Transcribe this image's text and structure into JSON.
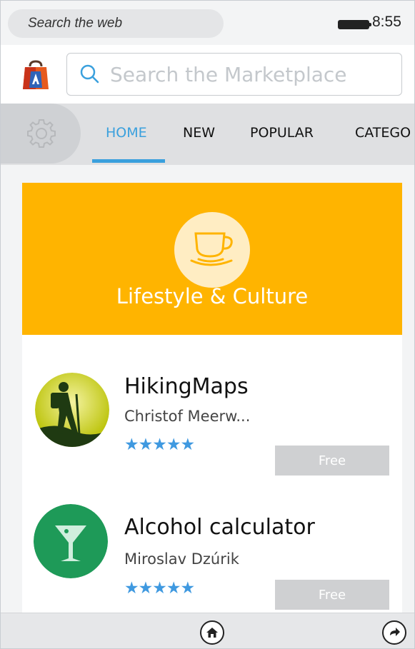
{
  "status_bar": {
    "search_text": "Search the web",
    "time": "8:55"
  },
  "marketplace_search": {
    "placeholder": "Search the Marketplace"
  },
  "tabs": [
    {
      "label": "HOME",
      "active": true
    },
    {
      "label": "NEW",
      "active": false
    },
    {
      "label": "POPULAR",
      "active": false
    },
    {
      "label": "CATEGO",
      "active": false
    }
  ],
  "banner": {
    "title": "Lifestyle & Culture",
    "icon": "coffee-cup-icon",
    "color": "#ffb400"
  },
  "apps": [
    {
      "name": "HikingMaps",
      "author": "Christof Meerw...",
      "rating": 5,
      "stars": "★★★★★",
      "price": "Free",
      "icon": "hiker-icon"
    },
    {
      "name": "Alcohol calculator",
      "author": "Miroslav Dzúrik",
      "rating": 5,
      "stars": "★★★★★",
      "price": "Free",
      "icon": "martini-glass-icon"
    }
  ],
  "toolbar": {
    "icons": [
      "home-icon",
      "reload-icon"
    ]
  },
  "colors": {
    "accent": "#3aa0dd",
    "star": "#3f99e0",
    "price_button": "#cfd0d2"
  }
}
